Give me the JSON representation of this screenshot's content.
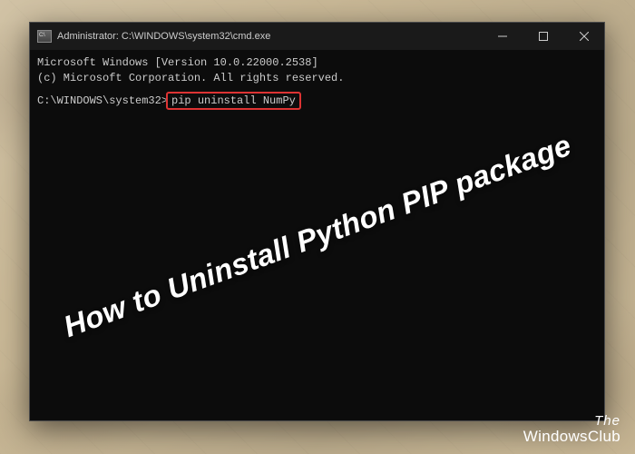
{
  "window": {
    "title": "Administrator: C:\\WINDOWS\\system32\\cmd.exe"
  },
  "terminal": {
    "line1": "Microsoft Windows [Version 10.0.22000.2538]",
    "line2": "(c) Microsoft Corporation. All rights reserved.",
    "prompt": "C:\\WINDOWS\\system32>",
    "command": "pip uninstall NumPy"
  },
  "overlay": {
    "headline": "How to Uninstall Python PIP package"
  },
  "watermark": {
    "line1": "The",
    "line2": "WindowsClub"
  }
}
